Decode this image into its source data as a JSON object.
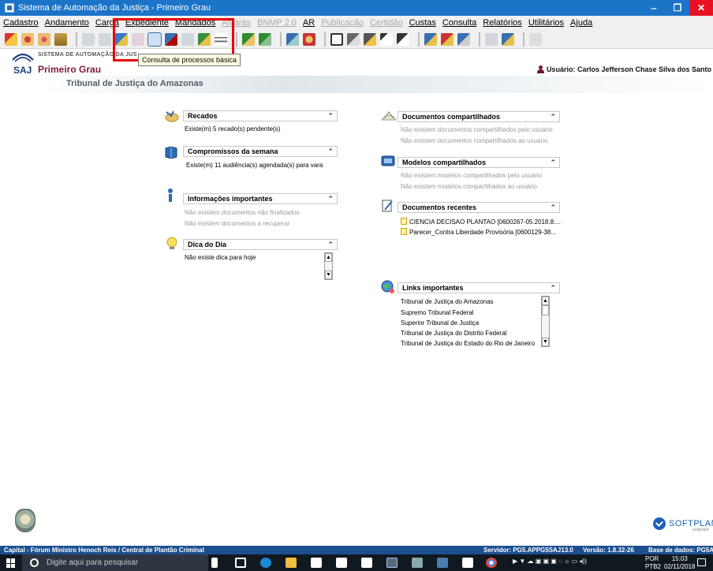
{
  "window": {
    "title": "Sistema de Automação da Justiça - Primeiro Grau",
    "buttons": {
      "minimize": "‒",
      "maximize": "❐",
      "close": "✕"
    }
  },
  "menu": [
    {
      "label": "Cadastro",
      "enabled": true
    },
    {
      "label": "Andamento",
      "enabled": true
    },
    {
      "label": "Carga",
      "enabled": true
    },
    {
      "label": "Expediente",
      "enabled": true
    },
    {
      "label": "Mandados",
      "enabled": true
    },
    {
      "label": "Alvarás",
      "enabled": false
    },
    {
      "label": "BNMP 2.0",
      "enabled": false
    },
    {
      "label": "AR",
      "enabled": true
    },
    {
      "label": "Publicação",
      "enabled": false
    },
    {
      "label": "Certidão",
      "enabled": false
    },
    {
      "label": "Custas",
      "enabled": true
    },
    {
      "label": "Consulta",
      "enabled": true
    },
    {
      "label": "Relatórios",
      "enabled": true
    },
    {
      "label": "Utilitários",
      "enabled": true
    },
    {
      "label": "Ajuda",
      "enabled": true
    }
  ],
  "header": {
    "brand_top": "SISTEMA DE AUTOMAÇÃO DA JUS",
    "brand_saj": "SAJ",
    "brand_grau": "Primeiro Grau",
    "tribunal": "Tribunal de Justiça do Amazonas",
    "user": "Usuário: Carlos Jefferson Chase Silva dos Santo"
  },
  "tooltip": "Consulta de processos básica",
  "panels": {
    "recados": {
      "title": "Recados",
      "lines": [
        "Existe(m) 5 recado(s) pendente(s)"
      ]
    },
    "compromissos": {
      "title": "Compromissos da semana",
      "lines": [
        "Existe(m) 11 audiência(s) agendada(s) para vara"
      ]
    },
    "informacoes": {
      "title": "Informações importantes",
      "lines": [
        "Não existem documentos não finalizados",
        "Não existem documentos a recuperar"
      ]
    },
    "dica": {
      "title": "Dica do Dia",
      "lines": [
        "Não existe dica para hoje"
      ]
    },
    "docs_compartilhados": {
      "title": "Documentos compartilhados",
      "lines": [
        "Não existem documentos compartilhados pelo usuário",
        "Não existem documentos compartilhados ao usuário"
      ]
    },
    "modelos": {
      "title": "Modelos compartilhados",
      "lines": [
        "Não existem modelos compartilhados pelo usuário",
        "Não existem modelos compartilhados ao usuário"
      ]
    },
    "recentes": {
      "title": "Documentos recentes",
      "lines": [
        "CIENCIA DECISAO PLANTAO [0600267-05.2018.8....",
        "Parecer_Contra Liberdade Provisória [0600129-38..."
      ]
    },
    "links": {
      "title": "Links importantes",
      "lines": [
        "Tribunal de Justiça do Amazonas",
        "Supremo Tribunal Federal",
        "Superior Tribunal de Justiça",
        "Tribunal de Justiça do Distrito Federal",
        "Tribunal de Justiça do Estado do Rio de Janeiro"
      ]
    }
  },
  "footer": {
    "brand": "SOFTPLAN",
    "brand_sub": "poligraph"
  },
  "statusbar": {
    "location": "Capital - Fórum Ministro Henoch Reis / Central de Plantão Criminal",
    "server": "Servidor: PG5.APPG5SAJ13.0",
    "version": "Versão: 1.8.32-26",
    "database": "Base de dados: PG5A"
  },
  "taskbar": {
    "search_placeholder": "Digite aqui para pesquisar",
    "lang": "POR",
    "lang2": "PTB2",
    "time": "15:03",
    "date": "02/11/2018"
  }
}
